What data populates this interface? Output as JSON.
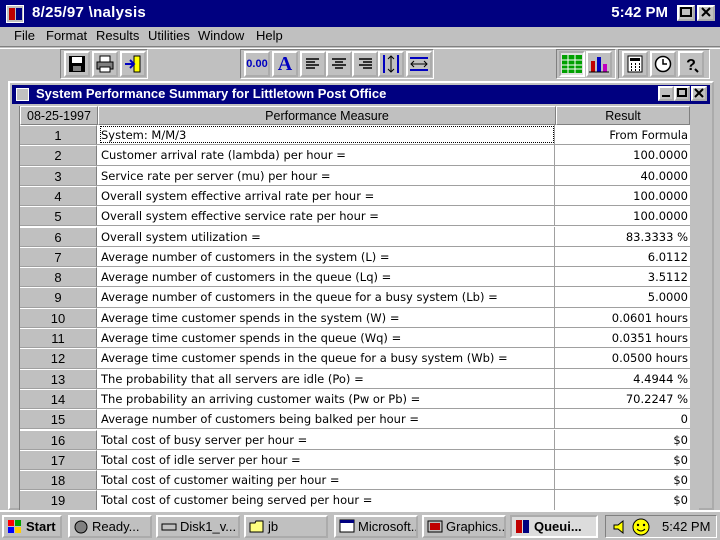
{
  "app": {
    "title": "8/25/97 \\nalysis",
    "clock": "5:42 PM"
  },
  "menu": [
    "File",
    "Format",
    "Results",
    "Utilities",
    "Window",
    "Help"
  ],
  "toolbar": {
    "decimal_label": "0.00",
    "font_label": "A",
    "icons": [
      "save-icon",
      "print-icon",
      "exit-icon",
      "decimal-icon",
      "font-icon",
      "align-left-icon",
      "align-center-icon",
      "align-right-icon",
      "row-height-icon",
      "column-width-icon",
      "spreadsheet-icon",
      "bar-chart-icon",
      "calculator-icon",
      "clock-icon",
      "help-icon"
    ]
  },
  "child_window": {
    "title": "System Performance Summary for Littletown Post Office"
  },
  "table": {
    "headers": [
      "08-25-1997",
      "Performance Measure",
      "Result"
    ],
    "rows": [
      {
        "n": "1",
        "measure": "System: M/M/3",
        "result": "From Formula"
      },
      {
        "n": "2",
        "measure": "Customer arrival rate (lambda) per hour =",
        "result": "100.0000"
      },
      {
        "n": "3",
        "measure": "Service rate per server (mu) per hour =",
        "result": "40.0000"
      },
      {
        "n": "4",
        "measure": "Overall system effective arrival rate per hour =",
        "result": "100.0000"
      },
      {
        "n": "5",
        "measure": "Overall system effective service rate per hour =",
        "result": "100.0000"
      },
      {
        "n": "6",
        "measure": "Overall system utilization =",
        "result": "83.3333 %"
      },
      {
        "n": "7",
        "measure": "Average number of customers in the system (L) =",
        "result": "6.0112"
      },
      {
        "n": "8",
        "measure": "Average number of customers in the queue (Lq) =",
        "result": "3.5112"
      },
      {
        "n": "9",
        "measure": "Average number of customers in the queue for a busy system (Lb) =",
        "result": "5.0000"
      },
      {
        "n": "10",
        "measure": "Average time customer spends in the system (W) =",
        "result": "0.0601 hours"
      },
      {
        "n": "11",
        "measure": "Average time customer spends in the queue (Wq) =",
        "result": "0.0351 hours"
      },
      {
        "n": "12",
        "measure": "Average time customer spends in the queue for a busy system (Wb) =",
        "result": "0.0500 hours"
      },
      {
        "n": "13",
        "measure": "The probability that all servers are idle (Po) =",
        "result": "4.4944 %"
      },
      {
        "n": "14",
        "measure": "The probability an arriving customer waits (Pw or Pb) =",
        "result": "70.2247 %"
      },
      {
        "n": "15",
        "measure": "Average number of customers being balked per hour =",
        "result": "0"
      },
      {
        "n": "16",
        "measure": "Total cost of busy server per hour =",
        "result": "$0"
      },
      {
        "n": "17",
        "measure": "Total cost of idle server per hour =",
        "result": "$0"
      },
      {
        "n": "18",
        "measure": "Total cost of customer waiting per hour =",
        "result": "$0"
      },
      {
        "n": "19",
        "measure": "Total cost of customer being served per hour =",
        "result": "$0"
      }
    ]
  },
  "taskbar": {
    "start": "Start",
    "tasks": [
      "Ready...",
      "Disk1_v...",
      "jb",
      "Microsoft...",
      "Graphics...",
      "Queui..."
    ],
    "clock": "5:42 PM"
  }
}
